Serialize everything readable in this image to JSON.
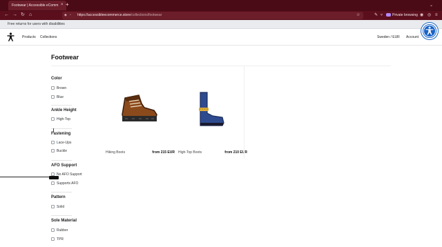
{
  "browser": {
    "tab_title": "Footwear | Accessible eComm",
    "tab_close": "×",
    "new_tab": "+",
    "url_host": "https://accessibleecommerce.store",
    "url_path": "/collections/footwear",
    "private_label": "Private browsing",
    "list_tabs": "⌄",
    "icons": [
      "back-icon",
      "forward-icon",
      "reload-icon",
      "home-icon",
      "shield-icon",
      "lock-icon",
      "star-icon",
      "extension-icon",
      "pocket-icon",
      "menu-icon"
    ]
  },
  "announcement": {
    "text": "Free returns for users with disabilities"
  },
  "header": {
    "nav": [
      "Products",
      "Collections"
    ],
    "region": "Sweden / EUR",
    "account": "Account"
  },
  "page": {
    "title": "Footwear"
  },
  "filters": [
    {
      "heading": "Color",
      "options": [
        "Brown",
        "Blue"
      ]
    },
    {
      "heading": "Ankle Height",
      "options": [
        "High-Top"
      ]
    },
    {
      "heading": "Fastening",
      "options": [
        "Lace-Ups",
        "Buckle"
      ]
    },
    {
      "heading": "AFO Support",
      "options": [
        "No AFO Support",
        "Supports AFO"
      ]
    },
    {
      "heading": "Pattern",
      "options": [
        "Solid"
      ]
    },
    {
      "heading": "Sole Material",
      "options": [
        "Rubber",
        "TPR"
      ]
    }
  ],
  "products": [
    {
      "name": "Hiking Boots",
      "price": "from 215 EUR",
      "color": "#8b4a1c"
    },
    {
      "name": "High-Top Boots",
      "price": "from 210 EUR",
      "color": "#2f4b8f"
    }
  ],
  "colors": {
    "tabbar": "#4a0b17",
    "navbar": "#5b0f1d",
    "accessibility": "#1863c7"
  }
}
